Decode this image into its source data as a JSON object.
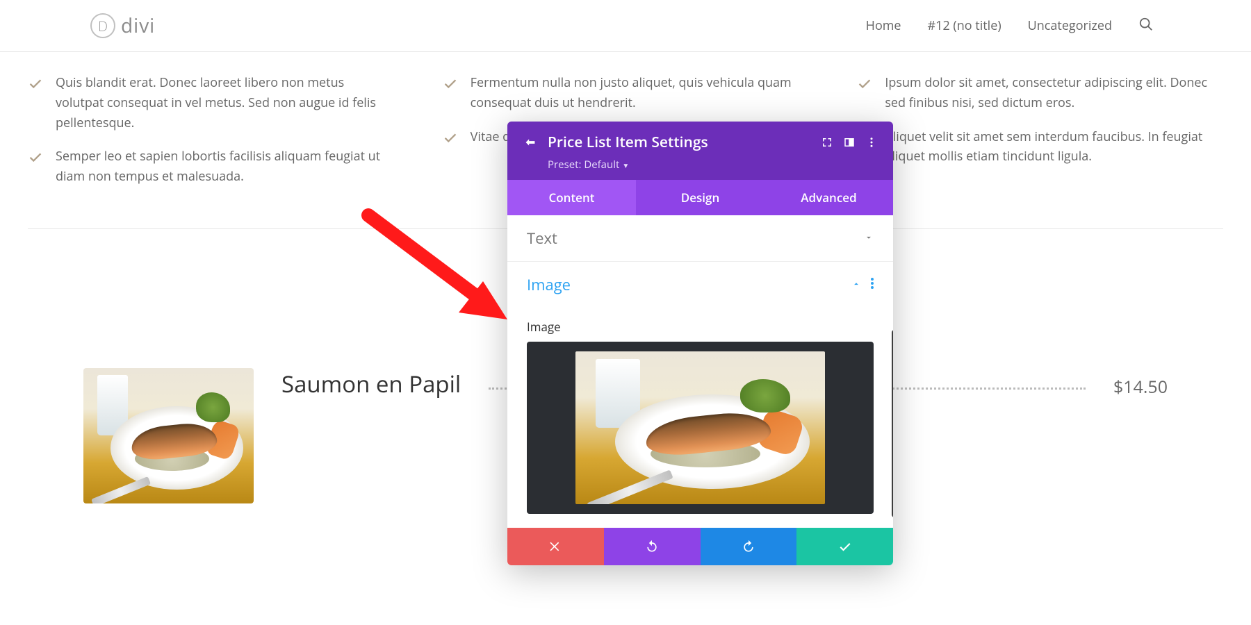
{
  "header": {
    "brand": "divi",
    "nav": {
      "home": "Home",
      "page12": "#12 (no title)",
      "uncat": "Uncategorized"
    }
  },
  "blurbs": {
    "col1_item1": "Quis blandit erat. Donec laoreet libero non metus volutpat consequat in vel metus. Sed non augue id felis pellentesque.",
    "col1_item2": "Semper leo et sapien lobortis facilisis aliquam feugiat ut diam non tempus et malesuada.",
    "col2_item1": "Fermentum nulla non justo aliquet, quis vehicula quam consequat duis ut hendrerit.",
    "col2_item2": "Vitae quam urna",
    "col3_item1": "Ipsum dolor sit amet, consectetur adipiscing elit. Donec sed finibus nisi, sed dictum eros.",
    "col3_item2": "Aliquet velit sit amet sem interdum faucibus. In feugiat aliquet mollis etiam tincidunt ligula."
  },
  "price_item": {
    "title": "Saumon en Papil",
    "price": "$14.50"
  },
  "modal": {
    "title": "Price List Item Settings",
    "preset_label": "Preset: Default",
    "tabs": {
      "content": "Content",
      "design": "Design",
      "advanced": "Advanced"
    },
    "acc_text": "Text",
    "acc_image": "Image",
    "field_image": "Image"
  }
}
